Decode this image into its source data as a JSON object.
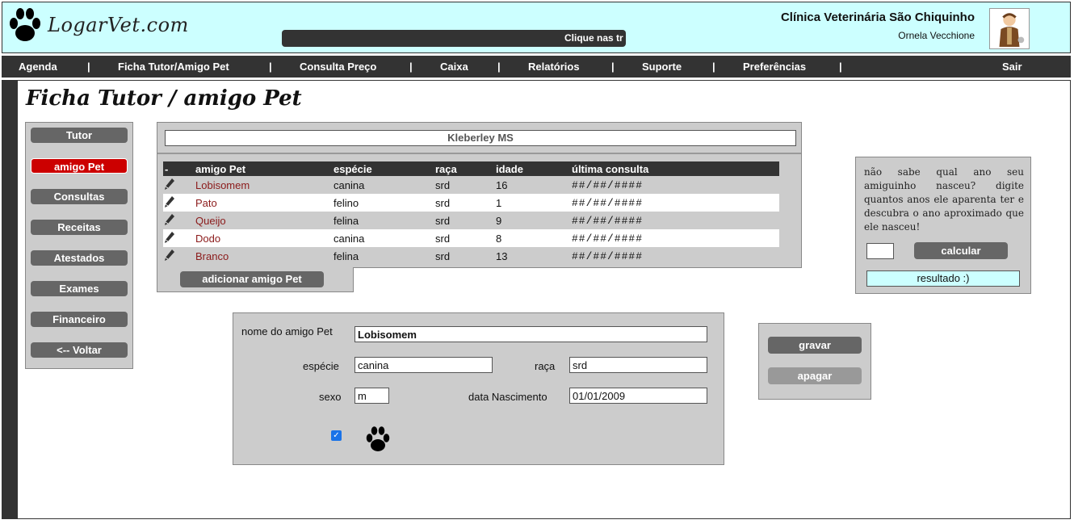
{
  "header": {
    "logo_text": "LogarVet.com",
    "marquee": "Clique nas tr",
    "clinic_name": "Clínica Veterinária São Chiquinho",
    "user_name": "Ornela Vecchione",
    "background_color": "#ccffff"
  },
  "nav": {
    "items": [
      "Agenda",
      "Ficha Tutor/Amigo Pet",
      "Consulta Preço",
      "Caixa",
      "Relatórios",
      "Suporte",
      "Preferências",
      "Sair"
    ],
    "separator": "|"
  },
  "page": {
    "title": "Ficha Tutor / amigo Pet"
  },
  "side_menu": {
    "items": [
      "Tutor",
      "amigo Pet",
      "Consultas",
      "Receitas",
      "Atestados",
      "Exames",
      "Financeiro",
      "<-- Voltar"
    ],
    "active": "amigo Pet",
    "active_color": "#cc0000"
  },
  "pet_list": {
    "tutor": "Kleberley MS",
    "columns": [
      "-",
      "amigo Pet",
      "espécie",
      "raça",
      "idade",
      "última consulta"
    ],
    "rows": [
      {
        "name": "Lobisomem",
        "species": "canina",
        "breed": "srd",
        "age": "16",
        "last": "##/##/####"
      },
      {
        "name": "Pato",
        "species": "felino",
        "breed": "srd",
        "age": "1",
        "last": "##/##/####"
      },
      {
        "name": "Queijo",
        "species": "felina",
        "breed": "srd",
        "age": "9",
        "last": "##/##/####"
      },
      {
        "name": "Dodo",
        "species": "canina",
        "breed": "srd",
        "age": "8",
        "last": "##/##/####"
      },
      {
        "name": "Branco",
        "species": "felina",
        "breed": "srd",
        "age": "13",
        "last": "##/##/####"
      }
    ],
    "add_button": "adicionar amigo Pet"
  },
  "calculator": {
    "text": "não sabe qual ano seu amiguinho nasceu? digite quantos anos ele aparenta ter e descubra o ano aproximado que ele nasceu!",
    "input_value": "",
    "button": "calcular",
    "result": "resultado :)"
  },
  "form": {
    "name_label": "nome do amigo Pet",
    "name_value": "Lobisomem",
    "species_label": "espécie",
    "species_value": "canina",
    "breed_label": "raça",
    "breed_value": "srd",
    "sex_label": "sexo",
    "sex_value": "m",
    "birth_label": "data Nascimento",
    "birth_value": "01/01/2009",
    "active_checked": true
  },
  "actions": {
    "save": "gravar",
    "delete": "apagar"
  }
}
